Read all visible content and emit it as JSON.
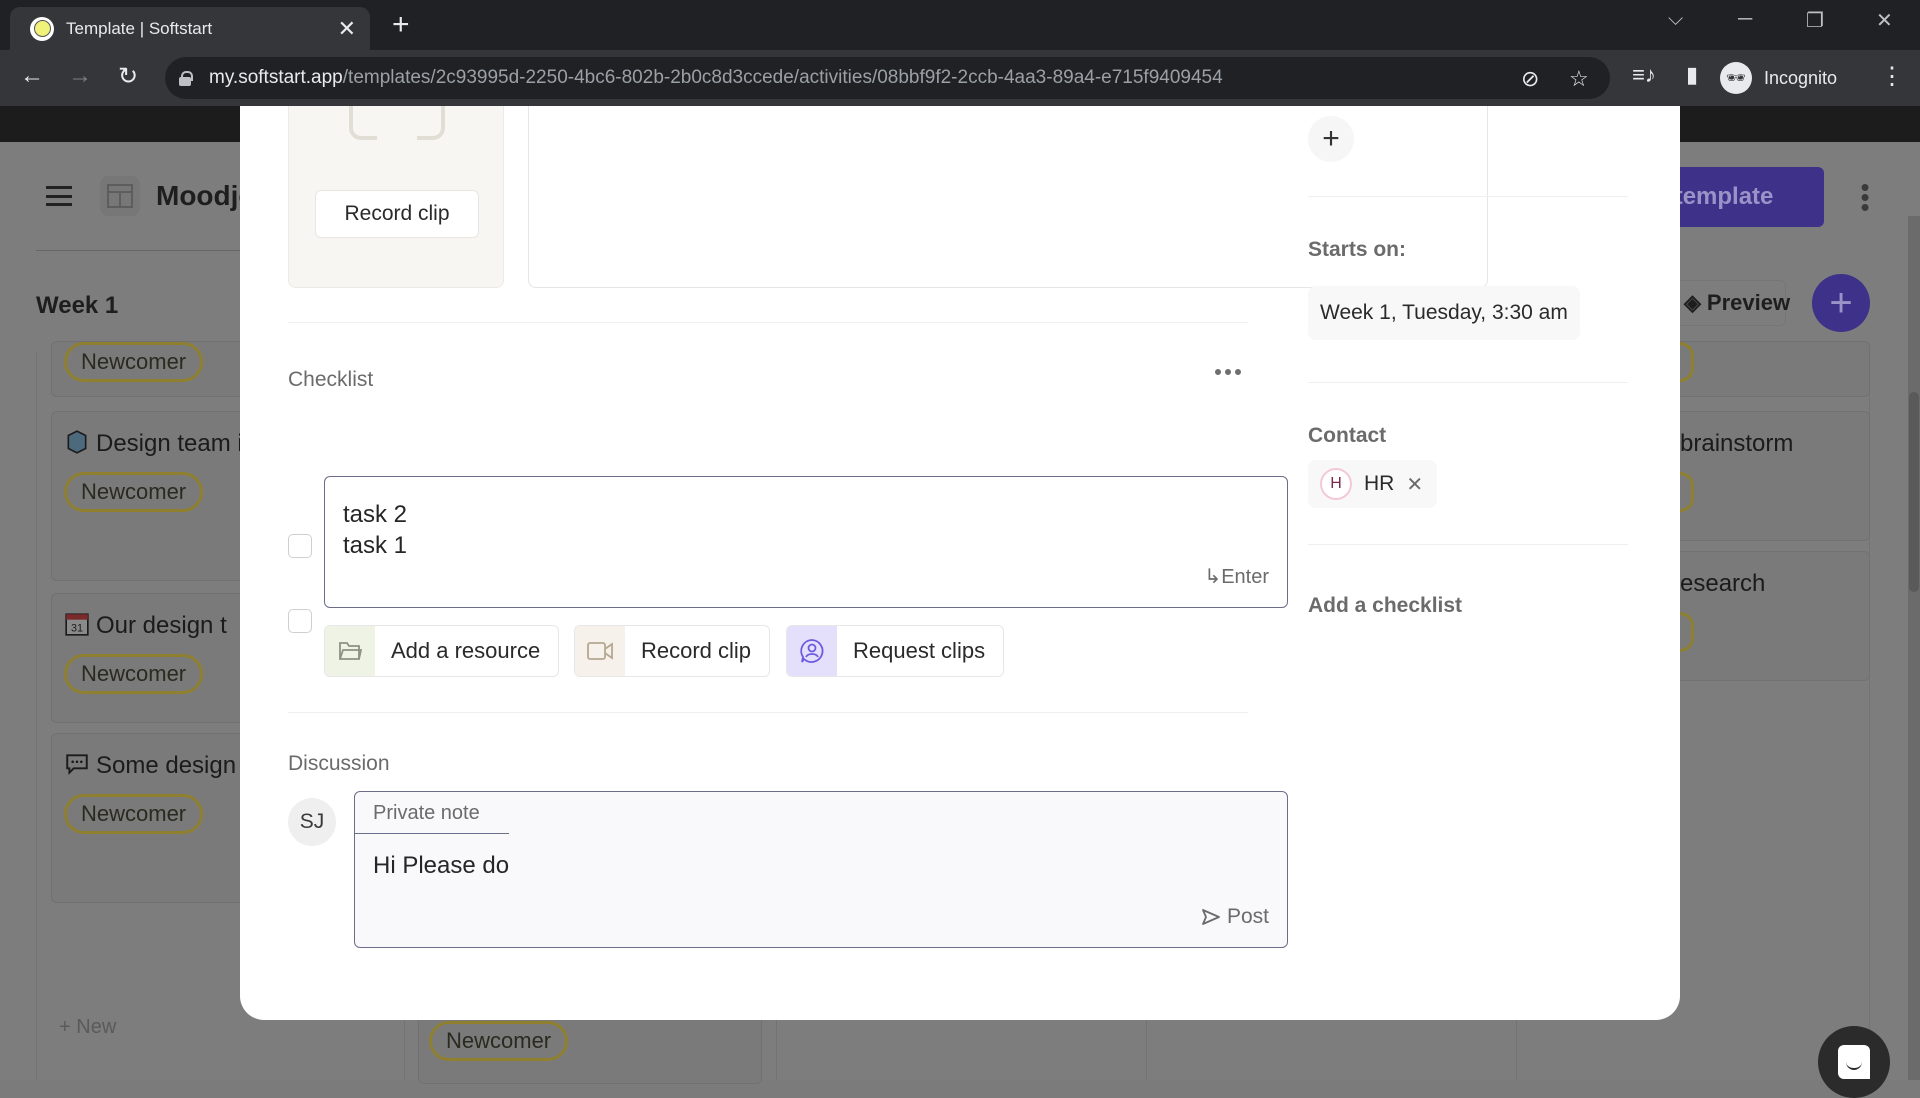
{
  "browser": {
    "tab_title": "Template | Softstart",
    "url_host": "my.softstart.app",
    "url_path": "/templates/2c93995d-2250-4bc6-802b-2b0c8d3ccede/activities/08bbf9f2-2ccb-4aa3-89a4-e715f9409454",
    "profile_label": "Incognito"
  },
  "background_page": {
    "project_name": "Moodjoy",
    "week_label": "Week 1",
    "publish_label": "Use template",
    "preview_label": "Preview",
    "new_label": "New",
    "left_cards": [
      {
        "title": "",
        "badge": "Newcomer"
      },
      {
        "icon": "cube",
        "title": "Design team icebreaker",
        "badge": "Newcomer"
      },
      {
        "icon": "calendar",
        "title": "Our design t",
        "badge": "Newcomer"
      },
      {
        "icon": "speech-bubble",
        "title": "Some design chat channels",
        "badge": "Newcomer"
      }
    ],
    "right_cards": [
      {
        "title": ""
      },
      {
        "title": "brainstorm"
      },
      {
        "title": "esearch"
      }
    ],
    "bottom_card_badge": "Newcomer"
  },
  "modal": {
    "clip_record_label": "Record clip",
    "checklist": {
      "title": "Checklist",
      "items": [
        {
          "label": "task 1",
          "checked": false
        },
        {
          "label": "task 2",
          "checked": false,
          "editing": true
        }
      ],
      "enter_hint": "Enter"
    },
    "actions": [
      {
        "label": "Add a resource",
        "icon": "folder",
        "color": "#eef3e6"
      },
      {
        "label": "Record clip",
        "icon": "video-camera",
        "color": "#f6f1ea"
      },
      {
        "label": "Request clips",
        "icon": "person-bubble",
        "color": "#e4e0fb"
      }
    ],
    "discussion": {
      "title": "Discussion",
      "avatar_initials": "SJ",
      "tab_label": "Private note",
      "draft_text": "Hi Please do",
      "post_label": "Post"
    },
    "sidebar": {
      "starts_on_label": "Starts on:",
      "starts_on_value": "Week 1, Tuesday, 3:30 am",
      "contact_label": "Contact",
      "contact_initial": "H",
      "contact_name": "HR",
      "add_checklist_label": "Add a checklist"
    }
  },
  "colors": {
    "brand": "#3e318a",
    "badge_border": "#8f8030",
    "focus_border": "#6b6d8a"
  }
}
